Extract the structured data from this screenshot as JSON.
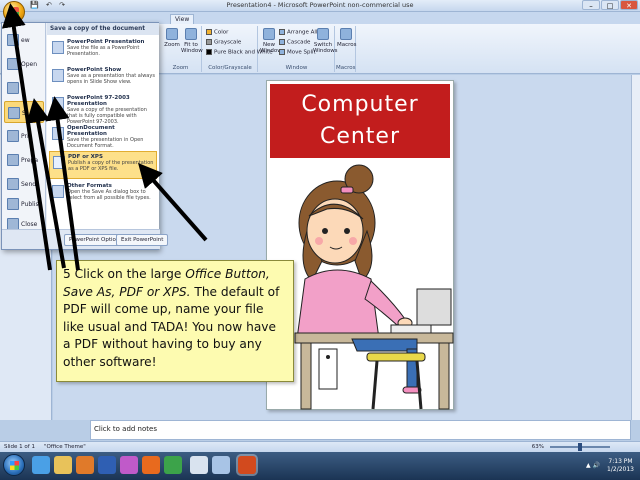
{
  "window": {
    "title": "Presentation4 - Microsoft PowerPoint non-commercial use",
    "qat_icons": [
      "save-icon",
      "undo-icon",
      "redo-icon"
    ]
  },
  "ribbon": {
    "visible_tab": "View",
    "groups": [
      {
        "label": "Zoom",
        "buttons": [
          "Zoom",
          "Fit to Window"
        ]
      },
      {
        "label": "Color/Grayscale",
        "items": [
          "Color",
          "Grayscale",
          "Pure Black and White"
        ]
      },
      {
        "label": "Window",
        "buttons": [
          "New Window"
        ],
        "items": [
          "Arrange All",
          "Cascade",
          "Move Split"
        ],
        "switch": "Switch Windows"
      },
      {
        "label": "Macros",
        "buttons": [
          "Macros"
        ]
      }
    ]
  },
  "office_menu": {
    "left_items": [
      "New",
      "Open",
      "Save",
      "Save As",
      "Print",
      "Prepare",
      "Send",
      "Publish",
      "Close"
    ],
    "left_visible": [
      "ew",
      "Open",
      "S",
      "Pri",
      "Prepa",
      "Send",
      "Publish",
      "Close"
    ],
    "header": "Save a copy of the document",
    "items": [
      {
        "title": "PowerPoint Presentation",
        "desc": "Save the file as a PowerPoint Presentation."
      },
      {
        "title": "PowerPoint Show",
        "desc": "Save as a presentation that always opens in Slide Show view."
      },
      {
        "title": "PowerPoint 97-2003 Presentation",
        "desc": "Save a copy of the presentation that is fully compatible with PowerPoint 97-2003."
      },
      {
        "title": "OpenDocument Presentation",
        "desc": "Save the presentation in Open Document Format."
      },
      {
        "title": "PDF or XPS",
        "desc": "Publish a copy of the presentation as a PDF or XPS file."
      },
      {
        "title": "Other Formats",
        "desc": "Open the Save As dialog box to select from all possible file types."
      }
    ],
    "footer": {
      "options": "PowerPoint Options",
      "exit": "Exit PowerPoint"
    }
  },
  "slide": {
    "line1": "Computer",
    "line2": "Center",
    "colors": {
      "banner": "#c21d1d",
      "shirt": "#f2a0c8",
      "desk": "#c8b89a",
      "chair": "#e9d84a"
    }
  },
  "callout": {
    "parts": [
      {
        "text": "5 Click on the large ",
        "italic": false
      },
      {
        "text": "Office Button, Save As, PDF or XPS.",
        "italic": true
      },
      {
        "text": " The default of PDF will come up, name your file like usual and TADA! You now have a PDF without having to buy any other software!",
        "italic": false
      }
    ]
  },
  "notes": {
    "placeholder": "Click to add notes"
  },
  "status": {
    "slide": "Slide 1 of 1",
    "theme": "\"Office Theme\"",
    "zoom": "63%"
  },
  "taskbar": {
    "time": "7:13 PM",
    "date": "1/2/2013",
    "apps": [
      "ie-icon",
      "folder-icon",
      "media-player-icon",
      "word-icon",
      "paint-icon",
      "firefox-icon",
      "chrome-icon",
      "notes-icon",
      "powerpoint-icon"
    ]
  }
}
